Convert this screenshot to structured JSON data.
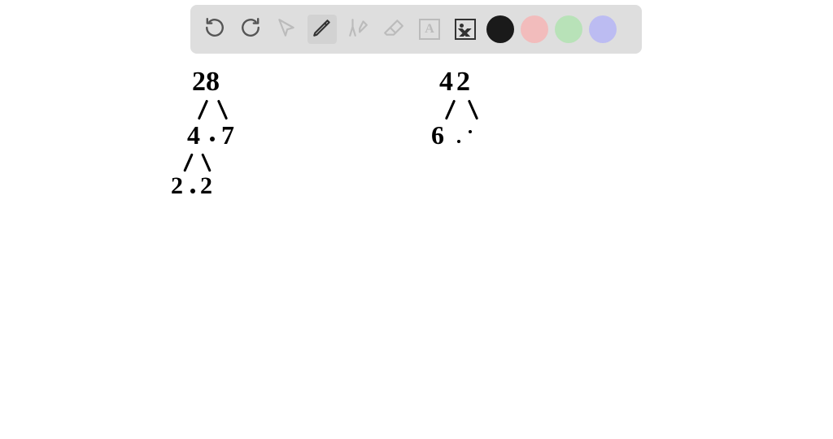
{
  "toolbar": {
    "tools": {
      "undo": "undo-icon",
      "redo": "redo-icon",
      "pointer": "pointer-icon",
      "pencil": "pencil-icon",
      "tools_disabled": "tools-icon",
      "eraser": "eraser-icon",
      "text": "A",
      "image": "image-icon"
    },
    "colors": {
      "black": "#1a1a1a",
      "pink": "#f2bcbc",
      "green": "#b8e2b8",
      "purple": "#bcbcf2"
    },
    "selected_tool": "pencil",
    "selected_color": "black"
  },
  "canvas": {
    "tree1": {
      "root": "28",
      "level2_left": "4",
      "level2_right": "7",
      "level3_left": "2",
      "level3_right": "2"
    },
    "tree2": {
      "root": "42",
      "level2_left": "6",
      "level2_right": ""
    }
  }
}
